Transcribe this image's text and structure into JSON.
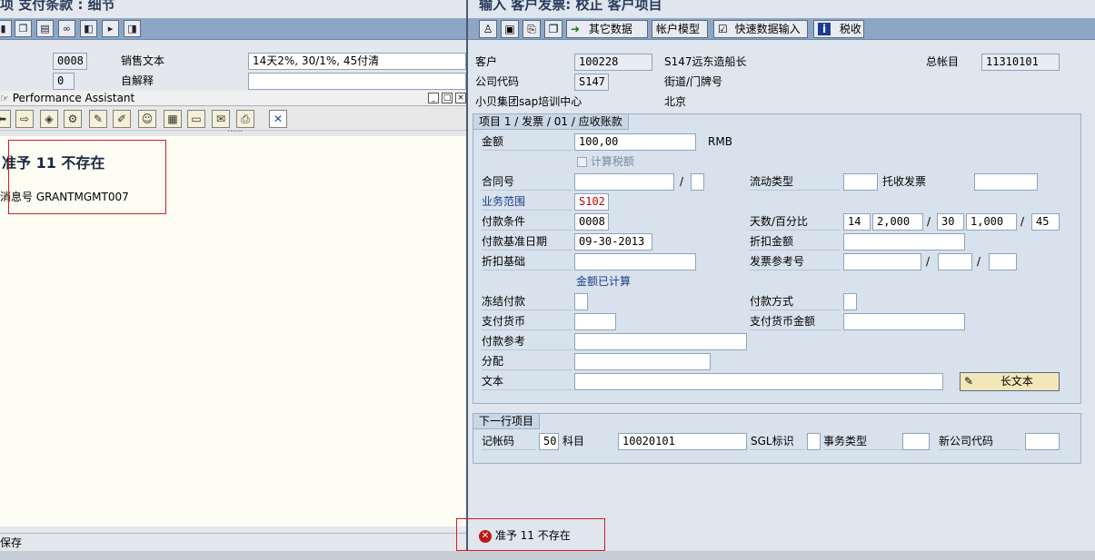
{
  "left": {
    "title": "项  支付条款 : 细节",
    "toolbar_icons": [
      "display-icon",
      "copy-icon",
      "save-icon",
      "link-icon",
      "first-icon",
      "next-icon",
      "last-icon"
    ],
    "fields": {
      "payment_terms_value": "0008",
      "sales_text_label": "销售文本",
      "sales_text_value": "14天2%, 30/1%, 45付清",
      "explanation_value": "0",
      "explanation_label": "自解释"
    },
    "performance_assistant": {
      "title": "Performance Assistant",
      "message_title": "准予  11 不存在",
      "message_no_label": "消息号",
      "message_no": "GRANTMGMT007",
      "dots": "......"
    },
    "status": "保存"
  },
  "right": {
    "title": "输入 客户发票: 校正 客户项目",
    "toolbar": {
      "other_data": "其它数据",
      "account_model": "帐户模型",
      "fast_entry": "快速数据输入",
      "tax": "税收"
    },
    "header": {
      "customer_label": "客户",
      "customer_value": "100228",
      "customer_name": "S147远东造船长",
      "gl_label": "总帐目",
      "gl_value": "11310101",
      "company_code_label": "公司代码",
      "company_code_value": "S147",
      "street_label": "街道/门牌号",
      "company_name": "小贝集团sap培训中心",
      "city": "北京"
    },
    "item_group": {
      "title": "项目 1 / 发票 / 01 / 应收账款",
      "amount_label": "金额",
      "amount_value": "100,00",
      "currency": "RMB",
      "calc_tax_label": "计算税额",
      "contract_label": "合同号",
      "contract_sep": "/",
      "flow_type_label": "流动类型",
      "bill_collect_label": "托收发票",
      "business_area_label": "业务范围",
      "business_area_value": "S102",
      "payment_terms_label": "付款条件",
      "payment_terms_value": "0008",
      "days_pct_label": "天数/百分比",
      "days1": "14",
      "pct1": "2,000",
      "sep1": "/",
      "days2": "30",
      "pct2": "1,000",
      "sep2": "/",
      "days3": "45",
      "baseline_date_label": "付款基准日期",
      "baseline_date_value": "09-30-2013",
      "discount_amount_label": "折扣金额",
      "discount_base_label": "折扣基础",
      "invoice_ref_label": "发票参考号",
      "invoice_ref_sep1": "/",
      "invoice_ref_sep2": "/",
      "amount_calculated": "金额已计算",
      "payment_block_label": "冻结付款",
      "payment_method_label": "付款方式",
      "payment_currency_label": "支付货币",
      "payment_currency_amount_label": "支付货币金额",
      "payment_ref_label": "付款参考",
      "assignment_label": "分配",
      "text_label": "文本",
      "long_text_button": "长文本"
    },
    "next_line": {
      "title": "下一行项目",
      "posting_key_label": "记帐码",
      "posting_key_value": "50",
      "account_label": "科目",
      "account_value": "10020101",
      "sgl_label": "SGL标识",
      "trans_type_label": "事务类型",
      "new_company_label": "新公司代码"
    },
    "status_message": "准予  11 不存在"
  }
}
